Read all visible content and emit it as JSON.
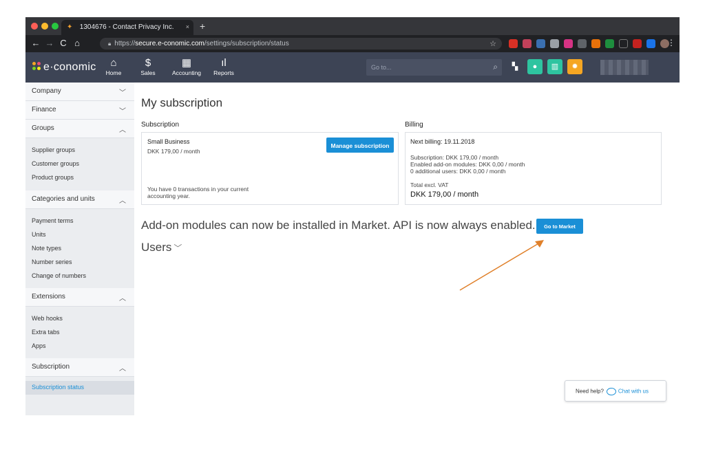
{
  "browser": {
    "tab_title": "1304676 - Contact Privacy Inc.",
    "tab_close": "×",
    "new_tab": "+",
    "url_scheme": "https://",
    "url_host": "secure.e-conomic.com",
    "url_path": "/settings/subscription/status",
    "nav": {
      "back": "←",
      "forward": "→",
      "reload": "C",
      "home": "⌂"
    },
    "star": "☆",
    "menu": "⋮"
  },
  "header": {
    "logo_text": "e·conomic",
    "nav": [
      {
        "label": "Home",
        "icon": "⌂"
      },
      {
        "label": "Sales",
        "icon": "$"
      },
      {
        "label": "Accounting",
        "icon": "▦"
      },
      {
        "label": "Reports",
        "icon": "ıl"
      }
    ],
    "search_placeholder": "Go to...",
    "search_icon": "⌕"
  },
  "sidebar": {
    "sections": [
      {
        "label": "Company",
        "chevron": "﹀"
      },
      {
        "label": "Finance",
        "chevron": "﹀"
      },
      {
        "label": "Groups",
        "chevron": "︿"
      },
      {
        "label": "Categories and units",
        "chevron": "︿"
      },
      {
        "label": "Extensions",
        "chevron": "︿"
      },
      {
        "label": "Subscription",
        "chevron": "︿"
      }
    ],
    "groups_items": [
      "Supplier groups",
      "Customer groups",
      "Product groups"
    ],
    "categories_items": [
      "Payment terms",
      "Units",
      "Note types",
      "Number series",
      "Change of numbers"
    ],
    "extensions_items": [
      "Web hooks",
      "Extra tabs",
      "Apps"
    ],
    "subscription_items": [
      "Subscription status"
    ]
  },
  "main": {
    "title": "My subscription",
    "subscription": {
      "heading": "Subscription",
      "plan": "Small Business",
      "price": "DKK 179,00 / month",
      "manage_button": "Manage subscription",
      "transactions_line1": "You have 0 transactions in your current",
      "transactions_line2": "accounting year."
    },
    "billing": {
      "heading": "Billing",
      "next_billing": "Next billing: 19.11.2018",
      "line1": "Subscription: DKK 179,00 / month",
      "line2": "Enabled add-on modules: DKK 0,00 / month",
      "line3": "0 additional users: DKK 0,00 / month",
      "total_label": "Total excl. VAT",
      "total_value": "DKK 179,00 / month"
    },
    "addon_text": "Add-on modules can now be installed in Market. API is now always enabled.",
    "market_button": "Go to Market",
    "users_label": "Users",
    "users_chevron": "﹀"
  },
  "help": {
    "label": "Need help?",
    "chat": "Chat with us"
  },
  "colors": {
    "accent": "#1a8fd6",
    "header_bg": "#3d4455",
    "arrow": "#e0802a"
  }
}
